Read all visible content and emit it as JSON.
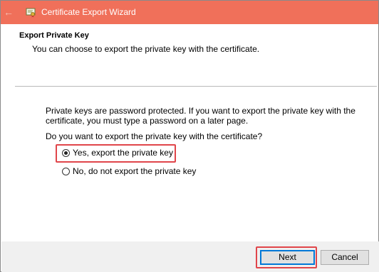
{
  "window": {
    "title": "Certificate Export Wizard",
    "back_icon": "arrow-left-icon",
    "app_icon": "certificate-icon",
    "accent_color": "#f0705a"
  },
  "header": {
    "title": "Export Private Key",
    "subtitle": "You can choose to export the private key with the certificate."
  },
  "body": {
    "paragraph": "Private keys are password protected. If you want to export the private key with the certificate, you must type a password on a later page.",
    "question": "Do you want to export the private key with the certificate?",
    "options": [
      {
        "label": "Yes, export the private key",
        "selected": true
      },
      {
        "label": "No, do not export the private key",
        "selected": false
      }
    ],
    "highlight_color": "#e0454a"
  },
  "footer": {
    "next_label": "Next",
    "cancel_label": "Cancel"
  }
}
